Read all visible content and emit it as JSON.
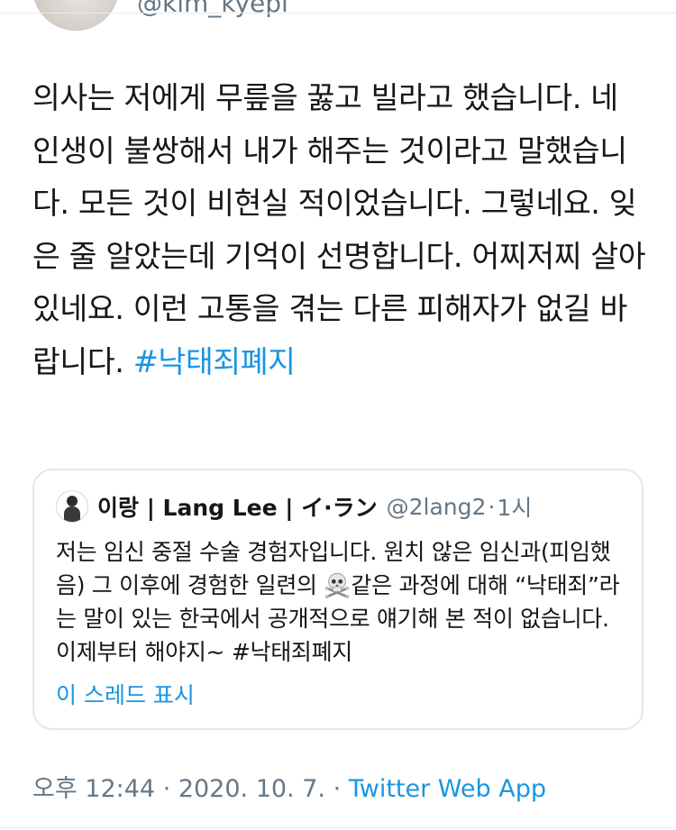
{
  "author": {
    "handle": "@kim_kyepi"
  },
  "tweet": {
    "text": "의사는 저에게 무릎을 꿇고 빌라고 했습니다. 네 인생이 불쌍해서 내가 해주는 것이라고 말했습니다. 모든 것이 비현실 적이었습니다. 그렇네요. 잊은 줄 알았는데 기억이 선명합니다. 어찌저찌 살아 있네요. 이런 고통을 겪는 다른 피해자가 없길 바랍니다. ",
    "hashtag": "#낙태죄폐지"
  },
  "quoted_tweet": {
    "name": "이랑 | Lang Lee | イ·ラン",
    "handle": "@2lang2",
    "separator": "·",
    "time": "1시",
    "text_part1": "저는 임신 중절 수술 경험자입니다. 원치 않은 임신과(피임했음) 그 이후에 경험한 일련의 ",
    "text_part2": "같은 과정에 대해 “낙태죄”라는 말이 있는 한국에서 공개적으로 얘기해 본 적이 없습니다. 이제부터 해야지~ ",
    "hashtag": "#낙태죄폐지",
    "skull_icon": "skull-crossbones-icon",
    "show_thread_label": "이 스레드 표시"
  },
  "meta": {
    "timestamp": "오후 12:44 · 2020. 10. 7.",
    "separator": " · ",
    "source": "Twitter Web App"
  },
  "colors": {
    "link": "#1b95e0",
    "secondary_text": "#657786",
    "border": "#e1e8ed"
  }
}
